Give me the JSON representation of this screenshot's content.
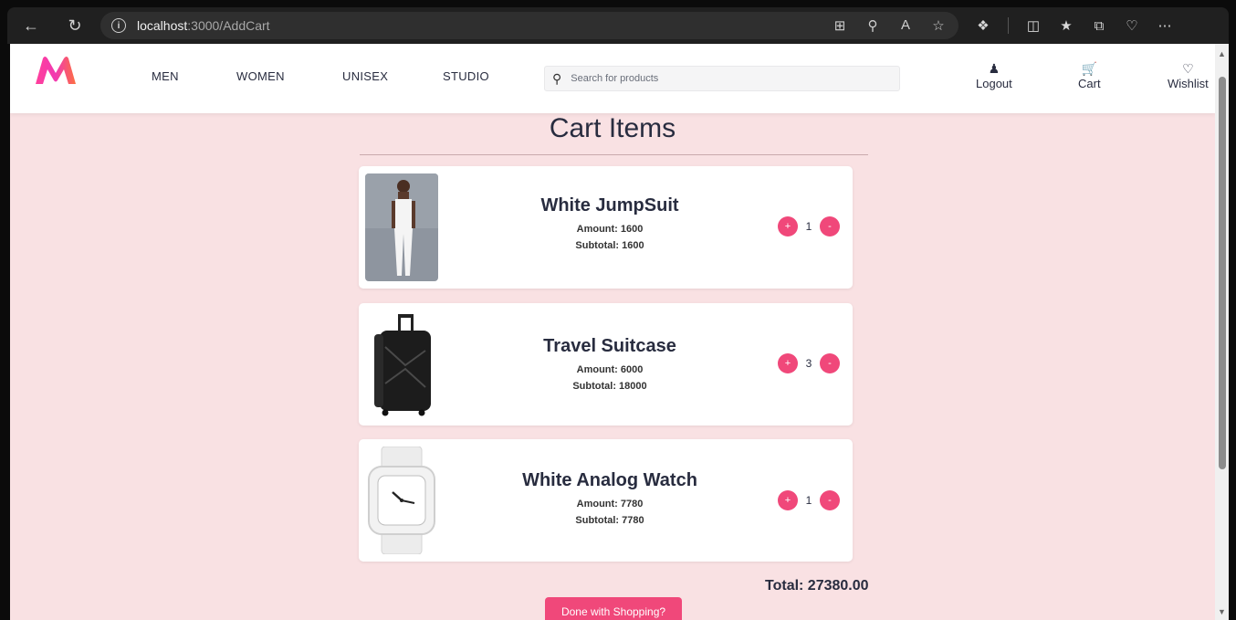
{
  "browser": {
    "url_host": "localhost",
    "url_path": ":3000/AddCart"
  },
  "header": {
    "nav": [
      "MEN",
      "WOMEN",
      "UNISEX",
      "STUDIO"
    ],
    "search_placeholder": "Search for products",
    "logout_label": "Logout",
    "cart_label": "Cart",
    "wishlist_label": "Wishlist"
  },
  "page": {
    "title": "Cart Items",
    "total": "Total: 27380.00",
    "done_label": "Done with Shopping?"
  },
  "items": [
    {
      "name": "White JumpSuit",
      "amount": "Amount: 1600",
      "subtotal": "Subtotal: 1600",
      "qty": "1"
    },
    {
      "name": "Travel Suitcase",
      "amount": "Amount: 6000",
      "subtotal": "Subtotal: 18000",
      "qty": "3"
    },
    {
      "name": "White Analog Watch",
      "amount": "Amount: 7780",
      "subtotal": "Subtotal: 7780",
      "qty": "1"
    }
  ],
  "qty_controls": {
    "plus": "+",
    "minus": "-"
  },
  "colors": {
    "accent": "#f0487a",
    "background": "#f9e1e3",
    "text": "#282c3f"
  }
}
